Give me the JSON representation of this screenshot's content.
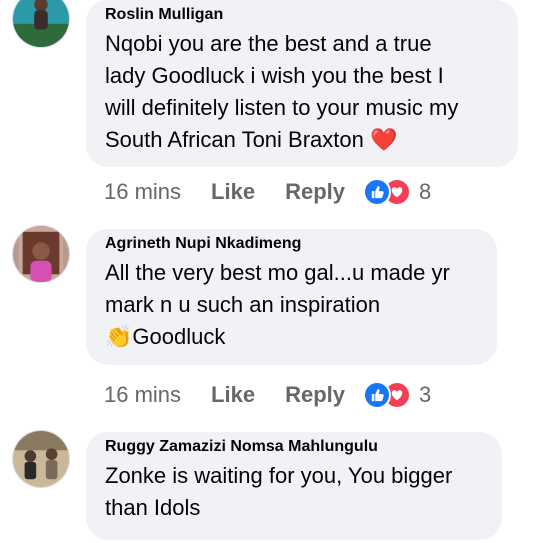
{
  "comments": [
    {
      "author": "Roslin Mulligan",
      "text_lines": [
        "Nqobi you are the best and a true",
        "lady Goodluck i wish you the best I",
        "will definitely listen to your music my",
        "South African Toni Braxton"
      ],
      "trailing_emoji": "❤️",
      "time": "16 mins",
      "like_label": "Like",
      "reply_label": "Reply",
      "reaction_count": "8"
    },
    {
      "author": "Agrineth Nupi Nkadimeng",
      "text_lines": [
        "All the very best mo gal...u made yr",
        "mark n u such an inspiration"
      ],
      "leading_emoji": "👏",
      "last_line": "Goodluck",
      "time": "16 mins",
      "like_label": "Like",
      "reply_label": "Reply",
      "reaction_count": "3"
    },
    {
      "author": "Ruggy Zamazizi Nomsa Mahlungulu",
      "text_lines": [
        "Zonke is waiting for you, You bigger",
        "than Idols"
      ]
    }
  ],
  "icons": {
    "like": "thumbs-up-icon",
    "love": "heart-icon"
  },
  "colors": {
    "bubble_bg": "#f0f2f5",
    "meta_text": "#65676b",
    "like_blue": "#1877f2",
    "love_red": "#f33e58"
  }
}
